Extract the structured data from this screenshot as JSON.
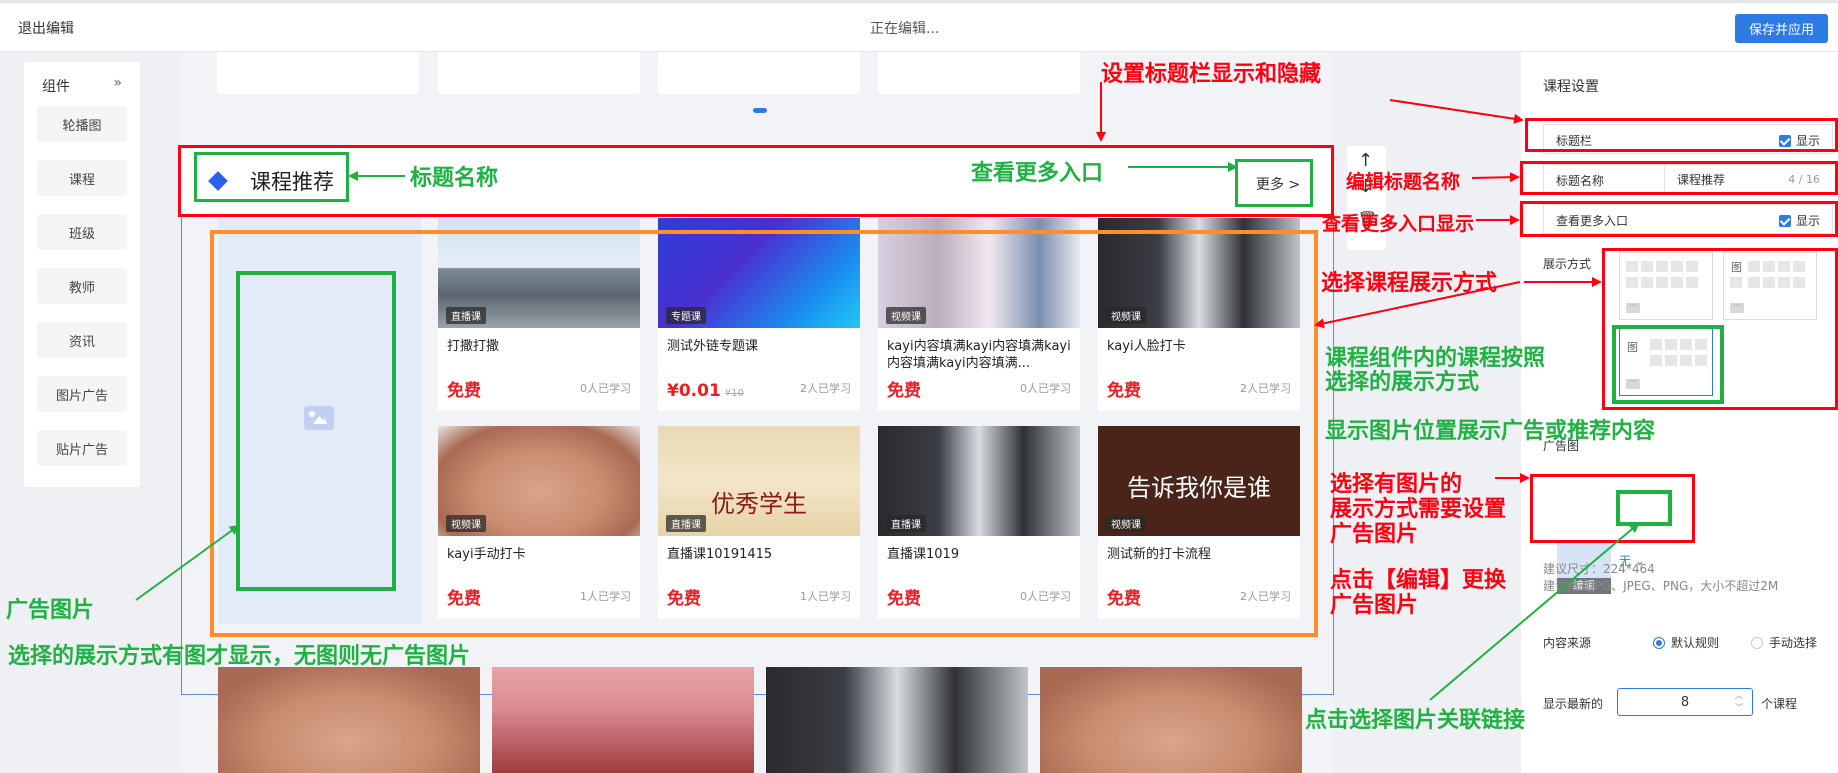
{
  "topbar": {
    "exit": "退出编辑",
    "status": "正在编辑...",
    "save": "保存并应用"
  },
  "components": {
    "title": "组件",
    "collapse_icon": "double-chevron-right-icon",
    "items": [
      "轮播图",
      "课程",
      "班级",
      "教师",
      "资讯",
      "图片广告",
      "贴片广告"
    ]
  },
  "section": {
    "title": "课程推荐",
    "more": "更多 >"
  },
  "courses": [
    {
      "tag": "直播课",
      "name": "打撒打撒",
      "price": "免费",
      "orig": "",
      "learners": "0人已学习",
      "img_text": ""
    },
    {
      "tag": "专题课",
      "name": "测试外链专题课",
      "price": "¥0.01",
      "orig": "¥10",
      "learners": "2人已学习",
      "img_text": ""
    },
    {
      "tag": "视频课",
      "name": "kayi内容填满kayi内容填满kayi内容填满kayi内容填满...",
      "price": "免费",
      "orig": "",
      "learners": "0人已学习",
      "img_text": ""
    },
    {
      "tag": "视频课",
      "name": "kayi人脸打卡",
      "price": "免费",
      "orig": "",
      "learners": "2人已学习",
      "img_text": ""
    },
    {
      "tag": "视频课",
      "name": "kayi手动打卡",
      "price": "免费",
      "orig": "",
      "learners": "1人已学习",
      "img_text": ""
    },
    {
      "tag": "直播课",
      "name": "直播课10191415",
      "price": "免费",
      "orig": "",
      "learners": "1人已学习",
      "img_text": "优秀学生"
    },
    {
      "tag": "直播课",
      "name": "直播课1019",
      "price": "免费",
      "orig": "",
      "learners": "0人已学习",
      "img_text": ""
    },
    {
      "tag": "视频课",
      "name": "测试新的打卡流程",
      "price": "免费",
      "orig": "",
      "learners": "2人已学习",
      "img_text": "告诉我你是谁"
    }
  ],
  "settings": {
    "title": "课程设置",
    "title_bar": {
      "label": "标题栏",
      "check": "显示"
    },
    "title_name": {
      "label": "标题名称",
      "value": "课程推荐",
      "count": "4 / 16"
    },
    "more_entry": {
      "label": "查看更多入口",
      "check": "显示"
    },
    "display_mode": {
      "label": "展示方式",
      "img_label": "图"
    },
    "ad": {
      "label": "广告图",
      "edit": "编辑",
      "link": "无",
      "hint_size": "建议尺寸：224*464",
      "hint_format": "建议格式JPG、JPEG、PNG，大小不超过2M"
    },
    "source": {
      "label": "内容来源",
      "opt1": "默认规则",
      "opt2": "手动选择"
    },
    "latest": {
      "label": "显示最新的",
      "value": "8",
      "suffix": "个课程"
    }
  },
  "annotations": {
    "title_bar_toggle": "设置标题栏显示和隐藏",
    "title_name": "标题名称",
    "more_entry": "查看更多入口",
    "edit_title_name": "编辑标题名称",
    "more_entry_display": "查看更多入口显示",
    "choose_display": "选择课程展示方式",
    "course_by_mode_1": "课程组件内的课程按照",
    "course_by_mode_2": "选择的展示方式",
    "image_position": "显示图片位置展示广告或推荐内容",
    "need_ad_1": "选择有图片的",
    "need_ad_2": "展示方式需要设置",
    "need_ad_3": "广告图片",
    "click_edit_1": "点击【编辑】更换",
    "click_edit_2": "广告图片",
    "ad_image": "广告图片",
    "ad_image_note": "选择的展示方式有图才显示，无图则无广告图片",
    "click_link": "点击选择图片关联链接"
  },
  "colors": {
    "accent": "#2c7be5",
    "annotation_red": "#ff0010",
    "annotation_green": "#1fb142",
    "price_red": "#ee1d23"
  }
}
